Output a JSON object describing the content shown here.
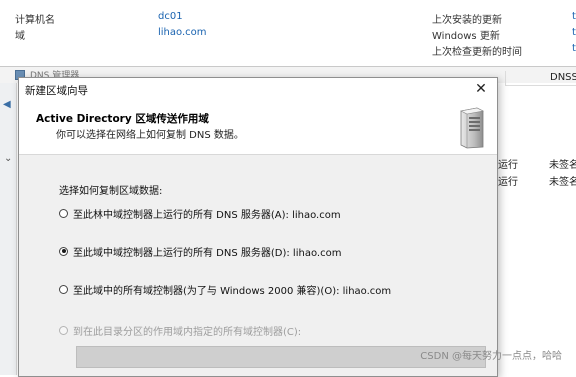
{
  "server_info": {
    "computer_name_label": "计算机名",
    "computer_name_value": "dc01",
    "domain_label": "域",
    "domain_value": "lihao.com",
    "last_installed_label": "上次安装的更新",
    "windows_update_label": "Windows 更新",
    "last_checked_label": "上次检查更新的时间"
  },
  "dns_manager": {
    "title": "DNS 管理器",
    "column_header": "DNSS",
    "rows": [
      {
        "status": "运行",
        "sign": "未签名"
      },
      {
        "status": "运行",
        "sign": "未签名"
      }
    ]
  },
  "wizard": {
    "title": "新建区域向导",
    "close_glyph": "✕",
    "heading": "Active Directory 区域传送作用域",
    "subheading": "你可以选择在网络上如何复制 DNS 数据。",
    "prompt": "选择如何复制区域数据:",
    "options": [
      {
        "label": "至此林中域控制器上运行的所有 DNS 服务器(A): lihao.com",
        "selected": false,
        "enabled": true
      },
      {
        "label": "至此域中域控制器上运行的所有 DNS 服务器(D): lihao.com",
        "selected": true,
        "enabled": true
      },
      {
        "label": "至此域中的所有域控制器(为了与 Windows 2000 兼容)(O): lihao.com",
        "selected": false,
        "enabled": true
      },
      {
        "label": "到在此目录分区的作用域内指定的所有域控制器(C):",
        "selected": false,
        "enabled": false
      }
    ]
  },
  "watermark": "CSDN @每天努力一点点，哈哈",
  "colors": {
    "link": "#1a63b0",
    "dialog_bg": "#f0f0f0",
    "disabled_text": "#9d9d9d"
  }
}
